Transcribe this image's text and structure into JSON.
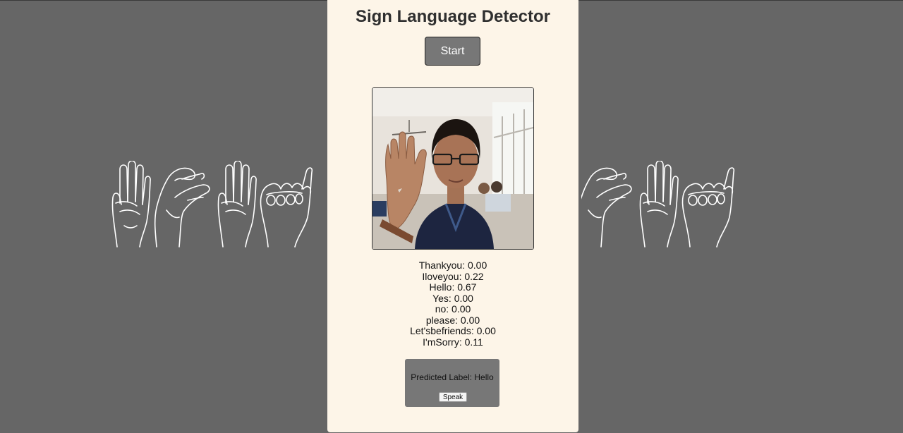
{
  "header": {
    "title": "Sign Language Detector"
  },
  "controls": {
    "start_label": "Start"
  },
  "predictions": [
    {
      "label": "Thankyou",
      "score": "0.00"
    },
    {
      "label": "Iloveyou",
      "score": "0.22"
    },
    {
      "label": "Hello",
      "score": "0.67"
    },
    {
      "label": "Yes",
      "score": "0.00"
    },
    {
      "label": "no",
      "score": "0.00"
    },
    {
      "label": "please",
      "score": "0.00"
    },
    {
      "label": "Let'sbefriends",
      "score": "0.00"
    },
    {
      "label": "I'mSorry",
      "score": "0.11"
    }
  ],
  "result": {
    "predicted_text": "Predicted Label: Hello",
    "speak_label": "Speak"
  },
  "colors": {
    "page_background": "#666666",
    "panel_background": "#fdf5e8",
    "button_gray": "#777777",
    "hand_lines": "#ffffff"
  },
  "icons": {
    "left_decoration": "asl-hands-illustration",
    "right_decoration": "asl-hands-illustration"
  }
}
